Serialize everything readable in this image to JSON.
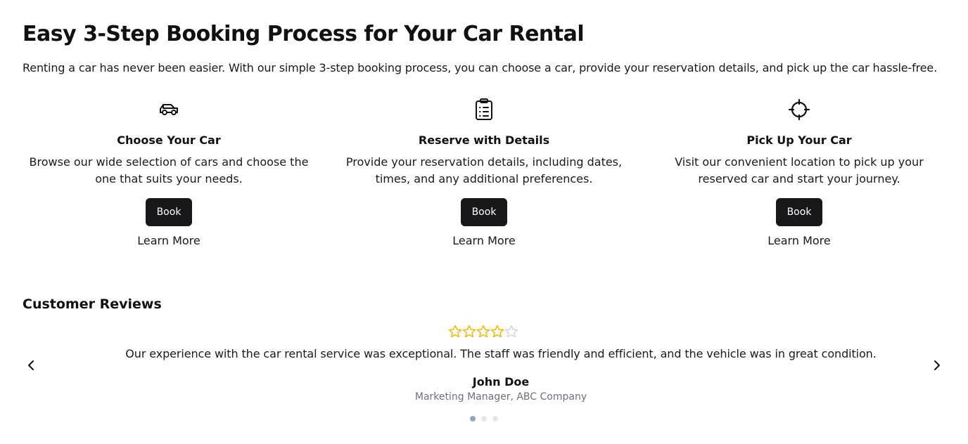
{
  "header": {
    "title": "Easy 3-Step Booking Process for Your Car Rental",
    "intro": "Renting a car has never been easier. With our simple 3-step booking process, you can choose a car, provide your reservation details, and pick up the car hassle-free."
  },
  "steps": [
    {
      "icon": "car-icon",
      "title": "Choose Your Car",
      "description": "Browse our wide selection of cars and choose the one that suits your needs.",
      "button_label": "Book",
      "link_label": "Learn More"
    },
    {
      "icon": "clipboard-list-icon",
      "title": "Reserve with Details",
      "description": "Provide your reservation details, including dates, times, and any additional preferences.",
      "button_label": "Book",
      "link_label": "Learn More"
    },
    {
      "icon": "crosshair-icon",
      "title": "Pick Up Your Car",
      "description": "Visit our convenient location to pick up your reserved car and start your journey.",
      "button_label": "Book",
      "link_label": "Learn More"
    }
  ],
  "reviews": {
    "title": "Customer Reviews",
    "current": {
      "rating": 4,
      "max_rating": 5,
      "text": "Our experience with the car rental service was exceptional. The staff was friendly and efficient, and the vehicle was in great condition.",
      "name": "John Doe",
      "role": "Marketing Manager, ABC Company"
    },
    "slide_count": 3,
    "active_slide": 1
  },
  "colors": {
    "star_filled": "#f5b800",
    "star_empty": "#d1d5db",
    "button_bg": "#18181b",
    "muted_text": "#6b7280"
  }
}
